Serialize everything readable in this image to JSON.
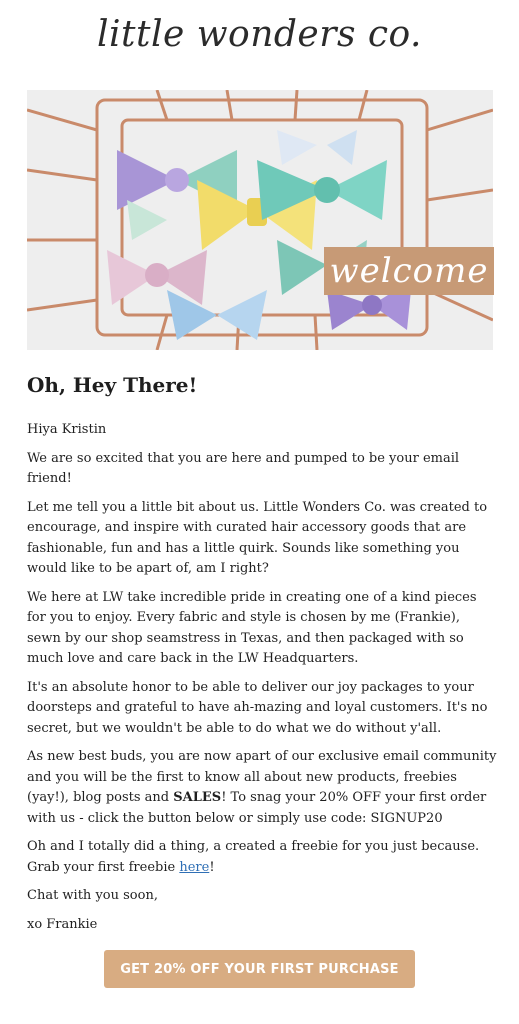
{
  "brand": {
    "logo_text": "little wonders co."
  },
  "hero": {
    "welcome_text": "welcome",
    "image_description_icon": "hair-bows-in-wire-basket-photo"
  },
  "content": {
    "heading": "Oh, Hey There!",
    "greeting": "Hiya Kristin",
    "p1": "We are so excited that you are here and pumped to be your email friend!",
    "p2": "Let me tell you a little bit about us.  Little Wonders Co. was created to encourage, and inspire with curated hair accessory goods that are fashionable, fun and has a little quirk.  Sounds like something you would like to be apart of, am I right?",
    "p3": "We here at LW take incredible pride in creating one of a kind pieces for you to enjoy. Every fabric and style is chosen by me (Frankie), sewn  by our shop seamstress in Texas, and then packaged with so much love and care back in the LW Headquarters.",
    "p4": "It's an absolute honor to be able to deliver our joy packages to your doorsteps and grateful to have ah-mazing and loyal customers.  It's no secret, but we wouldn't be able to do what we do without y'all.",
    "p5_before": "As new best buds, you are now apart of our exclusive email community and you will be the first to know all about new products, freebies (yay!), blog posts and ",
    "p5_bold": "SALES",
    "p5_after": "!  To snag your 20% OFF your first order with us - click the button below or simply use code: SIGNUP20",
    "p6_before": "Oh and I totally did a thing, a created a freebie for you just because.  Grab your first freebie ",
    "p6_link": "here",
    "p6_after": "!",
    "closing": "Chat with you soon,",
    "signature": "xo Frankie"
  },
  "cta": {
    "label": "GET 20% OFF YOUR FIRST PURCHASE"
  },
  "colors": {
    "badge": "#c79a76",
    "button": "#d8ac82",
    "link": "#2f6fb5"
  }
}
